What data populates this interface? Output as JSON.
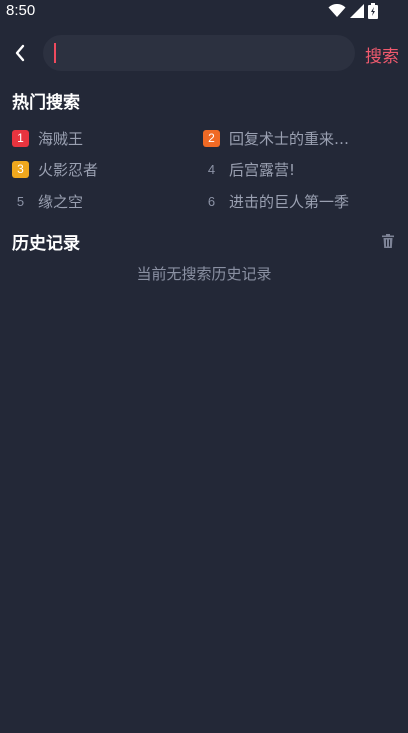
{
  "status_bar": {
    "time": "8:50",
    "icons": [
      "wifi-icon",
      "cellular-signal-icon",
      "battery-charging-icon"
    ]
  },
  "search": {
    "value": "",
    "placeholder": "",
    "button_label": "搜索",
    "accent_color": "#f05a6e"
  },
  "hot_search": {
    "title": "热门搜索",
    "items": [
      {
        "rank": "1",
        "label": "海贼王",
        "badge_color": "#e8343f"
      },
      {
        "rank": "2",
        "label": "回复术士的重来…",
        "badge_color": "#f06a25"
      },
      {
        "rank": "3",
        "label": "火影忍者",
        "badge_color": "#f0a81e"
      },
      {
        "rank": "4",
        "label": "后宫露营!",
        "badge_color": null
      },
      {
        "rank": "5",
        "label": "缘之空",
        "badge_color": null
      },
      {
        "rank": "6",
        "label": "进击的巨人第一季",
        "badge_color": null
      }
    ]
  },
  "history": {
    "title": "历史记录",
    "empty_text": "当前无搜索历史记录"
  }
}
